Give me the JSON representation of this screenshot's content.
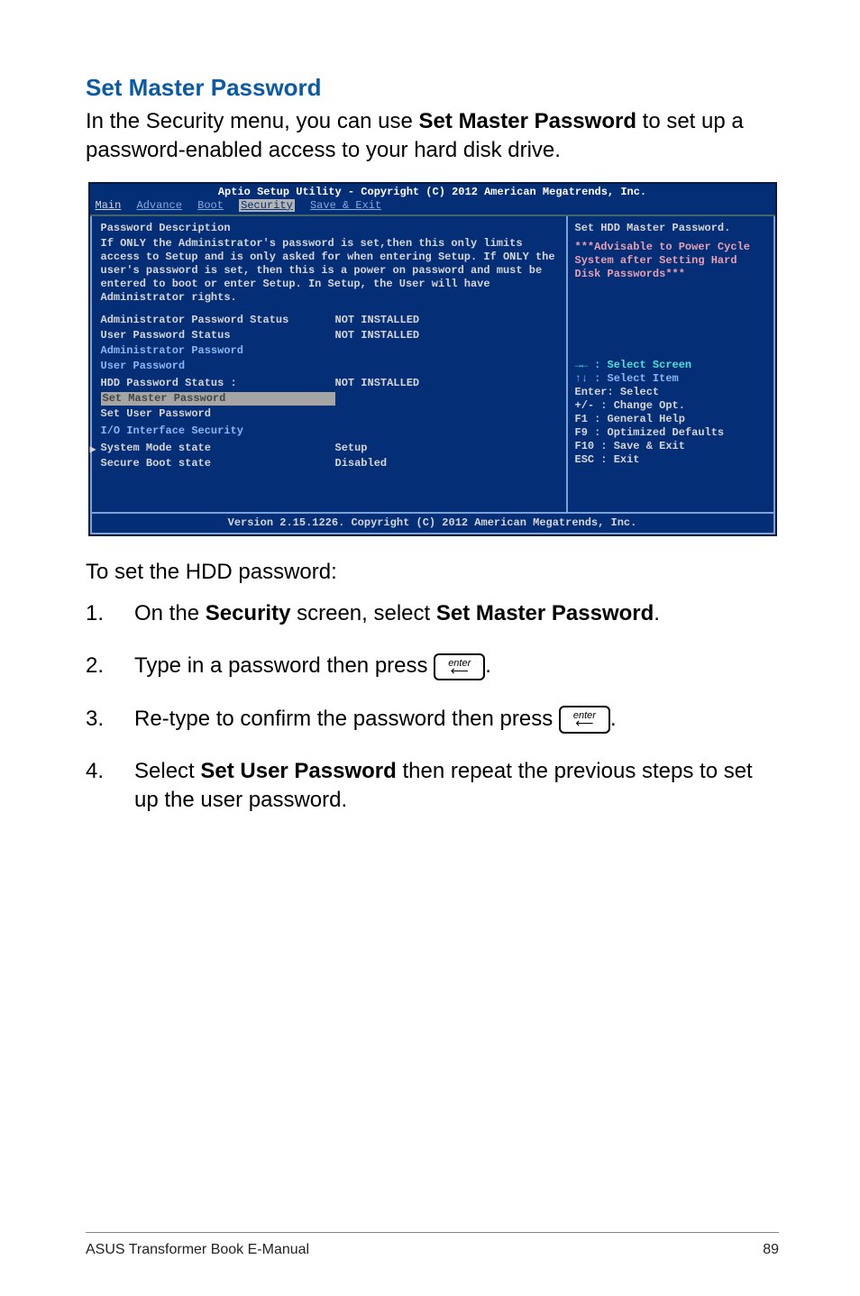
{
  "heading": "Set Master Password",
  "intro_pre": "In the Security menu, you can use ",
  "intro_bold": "Set Master Password",
  "intro_post": " to set up a password-enabled access to your hard disk drive.",
  "bios": {
    "header": "Aptio Setup Utility - Copyright (C) 2012 American Megatrends, Inc.",
    "tabs": {
      "main": "Main",
      "advance": "Advance",
      "boot": "Boot",
      "security": "Security",
      "save": "Save & Exit"
    },
    "left": {
      "title": "Password Description",
      "desc": "If ONLY the Administrator's password is set,then this only limits access to Setup and is only asked for when entering Setup. If ONLY the user's password is set, then this is a power on password and must be entered to boot or enter Setup. In Setup, the User will have Administrator rights.",
      "rows": [
        {
          "lbl": "Administrator Password Status",
          "val": "NOT INSTALLED",
          "cls": ""
        },
        {
          "lbl": "User Password Status",
          "val": "NOT INSTALLED",
          "cls": ""
        },
        {
          "lbl": "Administrator Password",
          "val": "",
          "cls": "blue"
        },
        {
          "lbl": "User Password",
          "val": "",
          "cls": "blue"
        },
        {
          "lbl": "",
          "val": "",
          "cls": ""
        },
        {
          "lbl": "HDD Password Status :",
          "val": "NOT INSTALLED",
          "cls": ""
        },
        {
          "lbl": "Set Master Password",
          "val": "",
          "cls": "grey"
        },
        {
          "lbl": "Set User Password",
          "val": "",
          "cls": ""
        },
        {
          "lbl": "",
          "val": "",
          "cls": ""
        },
        {
          "lbl": "I/O Interface Security",
          "val": "",
          "cls": "blue arrowrow"
        },
        {
          "lbl": "",
          "val": "",
          "cls": ""
        },
        {
          "lbl": "System Mode state",
          "val": "Setup",
          "cls": ""
        },
        {
          "lbl": "Secure Boot state",
          "val": "Disabled",
          "cls": ""
        }
      ],
      "arrow": "▶"
    },
    "right": {
      "title": "Set HDD Master Password.",
      "advisory": "***Advisable to Power Cycle System after Setting Hard Disk Passwords***",
      "help": [
        "→←  : Select Screen",
        "↑↓  : Select Item",
        "Enter: Select",
        "+/-  : Change Opt.",
        "F1   : General Help",
        "F9   : Optimized Defaults",
        "F10  : Save & Exit",
        "ESC  : Exit"
      ]
    },
    "footer": "Version 2.15.1226. Copyright (C) 2012 American Megatrends, Inc."
  },
  "subhead": "To set the HDD password:",
  "steps": {
    "s1_pre": "On the ",
    "s1_b1": "Security",
    "s1_mid": " screen, select ",
    "s1_b2": "Set Master Password",
    "s1_post": ".",
    "s2_pre": "Type in a password then press ",
    "s2_post": ".",
    "s3_pre": "Re-type to confirm the password then press ",
    "s3_post": ".",
    "s4_pre": "Select ",
    "s4_b": "Set User Password",
    "s4_post": " then repeat the previous steps to set up the user password."
  },
  "key_label": "enter",
  "footer": {
    "left": "ASUS Transformer Book E-Manual",
    "right": "89"
  }
}
